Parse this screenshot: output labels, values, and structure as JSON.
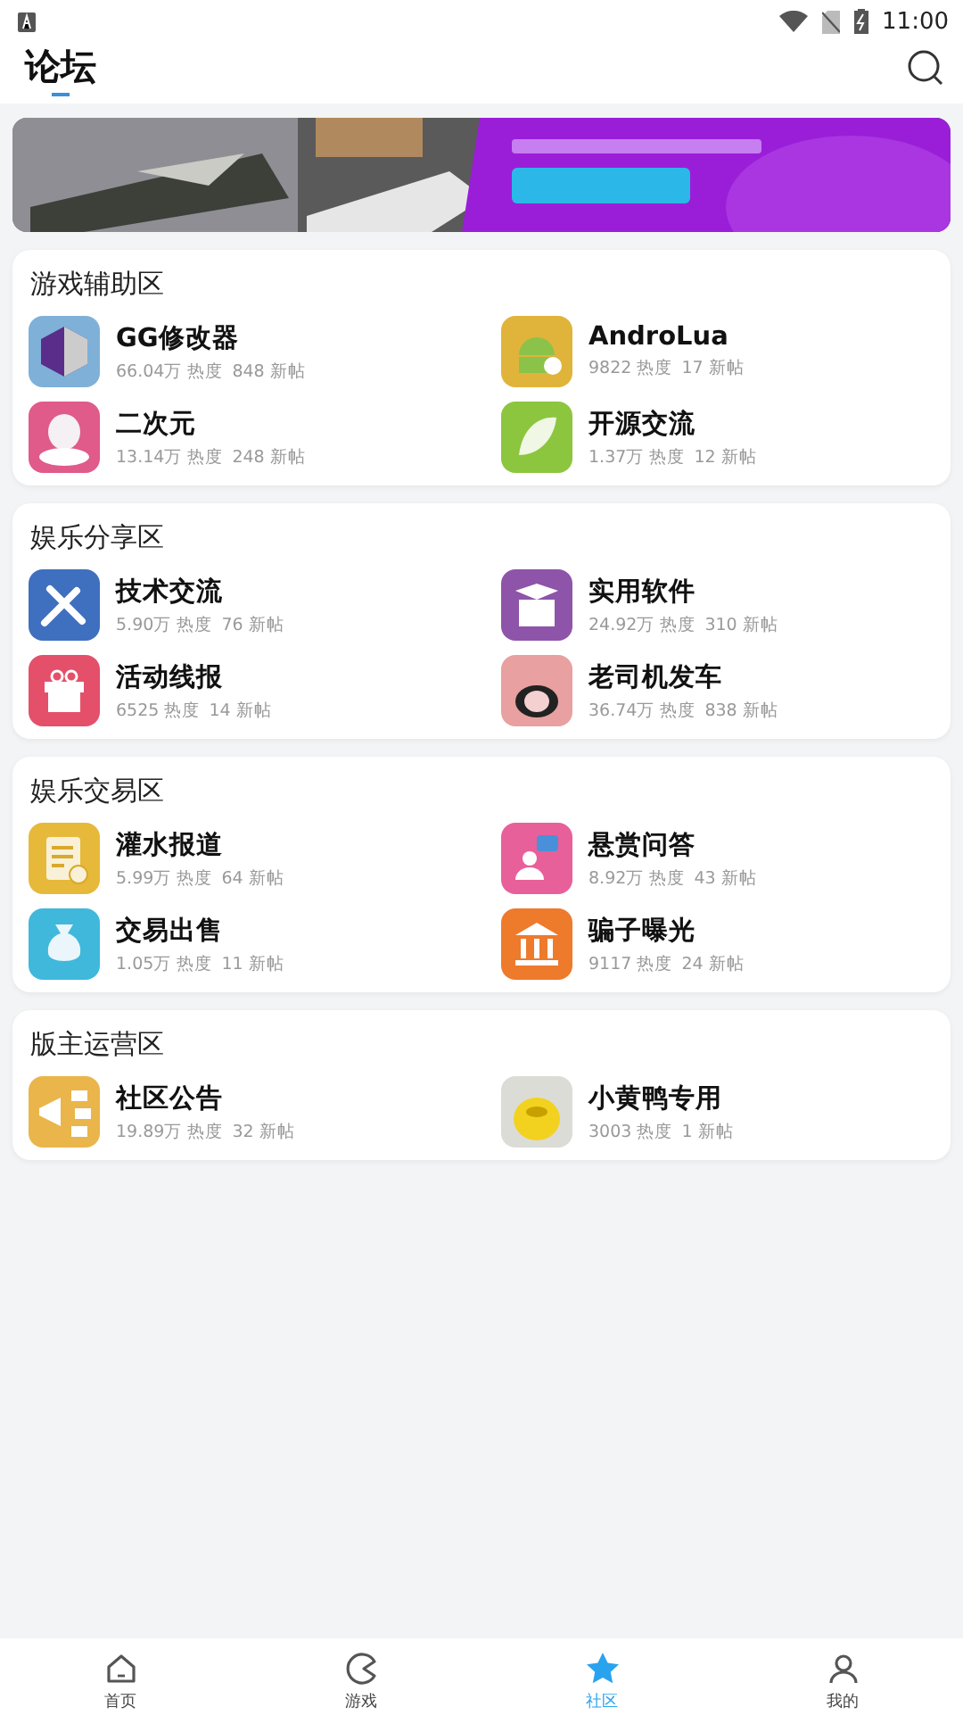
{
  "status_bar": {
    "time": "11:00"
  },
  "header": {
    "title": "论坛"
  },
  "sections": [
    {
      "title": "游戏辅助区",
      "items": [
        {
          "name": "GG修改器",
          "heat": "66.04万 热度",
          "posts": "848 新帖",
          "kind": "gg",
          "color": "#7fb0d8"
        },
        {
          "name": "AndroLua",
          "heat": "9822 热度",
          "posts": "17 新帖",
          "kind": "android",
          "color": "#e0b43a"
        },
        {
          "name": "二次元",
          "heat": "13.14万 热度",
          "posts": "248 新帖",
          "kind": "anime",
          "color": "#e05a8a"
        },
        {
          "name": "开源交流",
          "heat": "1.37万 热度",
          "posts": "12 新帖",
          "kind": "leaf",
          "color": "#8cc63f"
        }
      ]
    },
    {
      "title": "娱乐分享区",
      "items": [
        {
          "name": "技术交流",
          "heat": "5.90万 热度",
          "posts": "76 新帖",
          "kind": "tools",
          "color": "#3f6fbf"
        },
        {
          "name": "实用软件",
          "heat": "24.92万 热度",
          "posts": "310 新帖",
          "kind": "box",
          "color": "#8e54a9"
        },
        {
          "name": "活动线报",
          "heat": "6525 热度",
          "posts": "14 新帖",
          "kind": "gift",
          "color": "#e4506a"
        },
        {
          "name": "老司机发车",
          "heat": "36.74万 热度",
          "posts": "838 新帖",
          "kind": "panda",
          "color": "#e8a0a0"
        }
      ]
    },
    {
      "title": "娱乐交易区",
      "items": [
        {
          "name": "灌水报道",
          "heat": "5.99万 热度",
          "posts": "64 新帖",
          "kind": "doc",
          "color": "#e6b93a"
        },
        {
          "name": "悬赏问答",
          "heat": "8.92万 热度",
          "posts": "43 新帖",
          "kind": "question",
          "color": "#e8609a"
        },
        {
          "name": "交易出售",
          "heat": "1.05万 热度",
          "posts": "11 新帖",
          "kind": "money",
          "color": "#3fb8dc"
        },
        {
          "name": "骗子曝光",
          "heat": "9117 热度",
          "posts": "24 新帖",
          "kind": "bank",
          "color": "#ee7a2c"
        }
      ]
    },
    {
      "title": "版主运营区",
      "items": [
        {
          "name": "社区公告",
          "heat": "19.89万 热度",
          "posts": "32 新帖",
          "kind": "megaphone",
          "color": "#eab54a"
        },
        {
          "name": "小黄鸭专用",
          "heat": "3003 热度",
          "posts": "1 新帖",
          "kind": "duck",
          "color": "#dcdcd6"
        }
      ]
    }
  ],
  "tabs": [
    {
      "label": "首页",
      "kind": "home",
      "selected": false
    },
    {
      "label": "游戏",
      "kind": "game",
      "selected": false
    },
    {
      "label": "社区",
      "kind": "star",
      "selected": true
    },
    {
      "label": "我的",
      "kind": "user",
      "selected": false
    }
  ]
}
